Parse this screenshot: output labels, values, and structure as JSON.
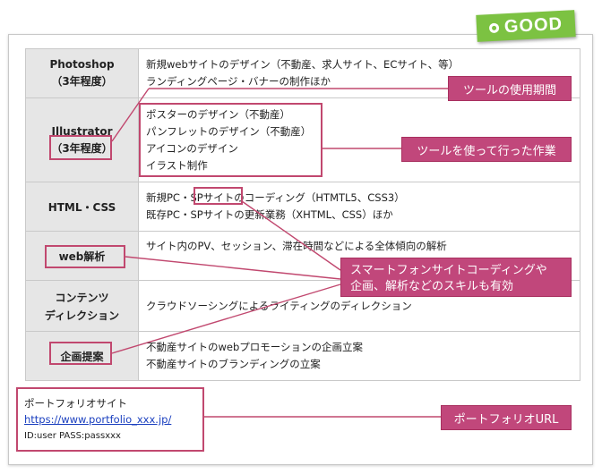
{
  "badge": {
    "label": "GOOD",
    "color": "#7cc242"
  },
  "accent_color": "#c1477b",
  "skills": [
    {
      "name": "Photoshop",
      "sub": "（3年程度）",
      "lines": [
        "新規webサイトのデザイン（不動産、求人サイト、ECサイト、等）",
        "ランディングページ・バナーの制作ほか"
      ]
    },
    {
      "name": "Illustrator",
      "sub": "（3年程度）",
      "lines": [
        "ポスターのデザイン（不動産）",
        "パンフレットのデザイン（不動産）",
        "アイコンのデザイン",
        "イラスト制作"
      ]
    },
    {
      "name": "HTML・CSS",
      "sub": "",
      "lines": [
        "新規PC・SPサイトのコーディング（HTMTL5、CSS3）",
        "既存PC・SPサイトの更新業務（XHTML、CSS）ほか"
      ]
    },
    {
      "name": "web解析",
      "sub": "",
      "lines": [
        "サイト内のPV、セッション、滞在時間などによる全体傾向の解析"
      ]
    },
    {
      "name": "コンテンツ",
      "sub": "ディレクション",
      "lines": [
        "クラウドソーシングによるライティングのディレクション"
      ]
    },
    {
      "name": "企画提案",
      "sub": "",
      "lines": [
        "不動産サイトのwebプロモーションの企画立案",
        "不動産サイトのブランディングの立案"
      ]
    }
  ],
  "callouts": {
    "tool_period": "ツールの使用期間",
    "tool_work": "ツールを使って行った作業",
    "skills_line1": "スマートフォンサイトコーディングや",
    "skills_line2": "企画、解析などのスキルも有効",
    "portfolio_url": "ポートフォリオURL"
  },
  "portfolio": {
    "title": "ポートフォリオサイト",
    "url": "https://www.portfolio_xxx.jp/",
    "credentials": "ID:user PASS:passxxx"
  }
}
